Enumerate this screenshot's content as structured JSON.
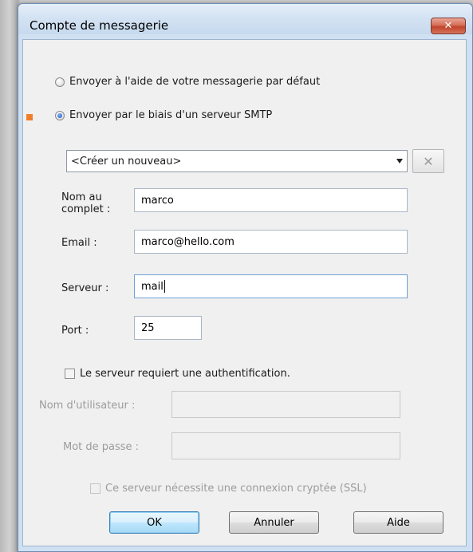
{
  "window": {
    "title": "Compte de messagerie",
    "close_glyph": "✕"
  },
  "send_options": {
    "default_label": "Envoyer à l'aide de votre messagerie par défaut",
    "smtp_label": "Envoyer par le biais d'un serveur SMTP",
    "selected": "smtp"
  },
  "server_select": {
    "value": "<Créer un nouveau>",
    "delete_glyph": "✕"
  },
  "fields": {
    "full_name_label_line1": "Nom au",
    "full_name_label_line2": "complet :",
    "full_name_value": "marco",
    "email_label": "Email :",
    "email_value": "marco@hello.com",
    "server_label": "Serveur :",
    "server_value": "mail",
    "port_label": "Port :",
    "port_value": "25"
  },
  "auth": {
    "checkbox_label": "Le serveur requiert une authentification.",
    "checked": false,
    "username_label": "Nom d'utilisateur :",
    "username_value": "",
    "password_label": "Mot de passe :",
    "password_value": "",
    "ssl_label": "Ce serveur nécessite une connexion cryptée (SSL)",
    "ssl_checked": false
  },
  "buttons": {
    "ok": "OK",
    "cancel": "Annuler",
    "help": "Aide"
  },
  "colors": {
    "annotation": "#f07f2c",
    "close_button": "#c0432a",
    "window_frame": "#cfe0f2"
  }
}
